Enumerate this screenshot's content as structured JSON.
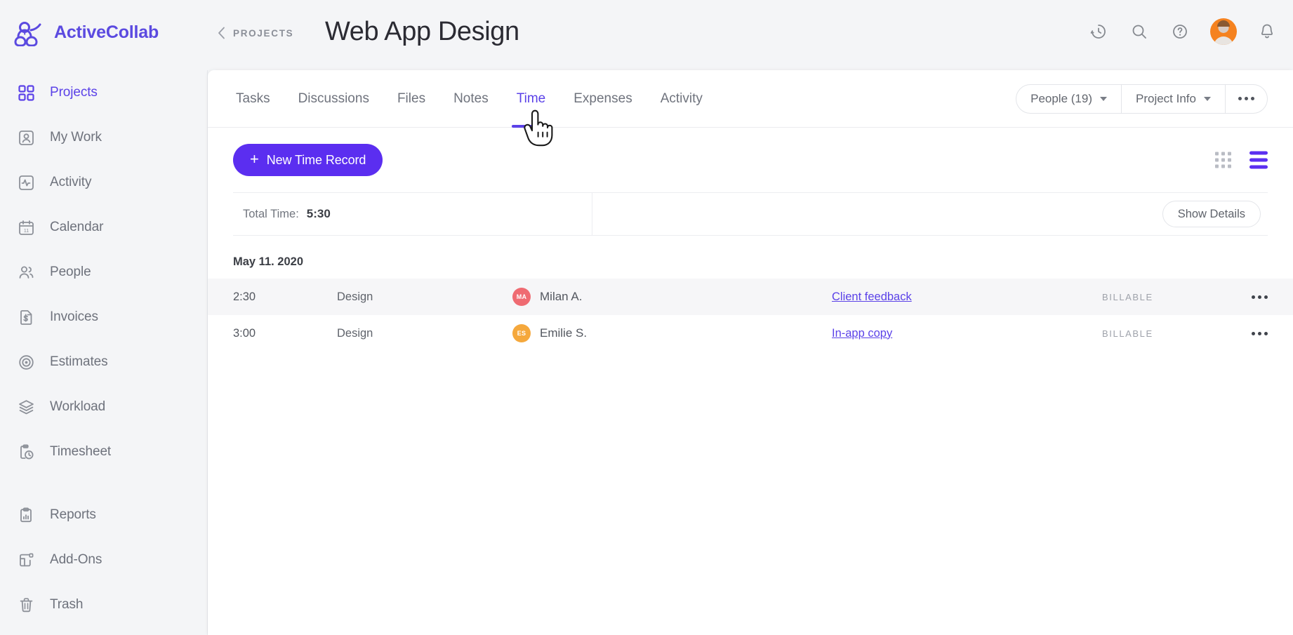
{
  "brand": {
    "name": "ActiveCollab",
    "logo_icon": "activecollab-logo-icon"
  },
  "header": {
    "breadcrumb_label": "PROJECTS",
    "breadcrumb_icon": "chevron-left-icon",
    "title": "Web App Design",
    "actions": [
      {
        "icon": "timer-clock-icon",
        "name": "timer-button"
      },
      {
        "icon": "search-icon",
        "name": "search-button"
      },
      {
        "icon": "help-question-icon",
        "name": "help-button"
      },
      {
        "icon": "avatar-icon",
        "name": "user-avatar"
      },
      {
        "icon": "bell-notification-icon",
        "name": "notifications-button"
      }
    ],
    "accent_color": "#5b42e8",
    "avatar_color": "#f5821f"
  },
  "sidebar": {
    "items": [
      {
        "label": "Projects",
        "icon": "grid-squares-icon",
        "active": true
      },
      {
        "label": "My Work",
        "icon": "person-card-icon",
        "active": false
      },
      {
        "label": "Activity",
        "icon": "pulse-chart-icon",
        "active": false
      },
      {
        "label": "Calendar",
        "icon": "calendar-icon",
        "active": false
      },
      {
        "label": "People",
        "icon": "people-icon",
        "active": false
      },
      {
        "label": "Invoices",
        "icon": "invoice-dollar-icon",
        "active": false
      },
      {
        "label": "Estimates",
        "icon": "target-icon",
        "active": false
      },
      {
        "label": "Workload",
        "icon": "layers-icon",
        "active": false
      },
      {
        "label": "Timesheet",
        "icon": "clipboard-clock-icon",
        "active": false
      }
    ],
    "items_bottom": [
      {
        "label": "Reports",
        "icon": "clipboard-chart-icon",
        "active": false
      },
      {
        "label": "Add-Ons",
        "icon": "addons-icon",
        "active": false
      },
      {
        "label": "Trash",
        "icon": "trash-icon",
        "active": false
      }
    ]
  },
  "main": {
    "tabs": [
      {
        "label": "Tasks",
        "active": false
      },
      {
        "label": "Discussions",
        "active": false
      },
      {
        "label": "Files",
        "active": false
      },
      {
        "label": "Notes",
        "active": false
      },
      {
        "label": "Time",
        "active": true
      },
      {
        "label": "Expenses",
        "active": false
      },
      {
        "label": "Activity",
        "active": false
      }
    ],
    "segmented": {
      "people_label": "People (19)",
      "project_info_label": "Project Info",
      "more_icon": "ellipsis-horizontal-icon"
    },
    "new_record_button": {
      "label": "New Time Record",
      "plus": "+"
    },
    "view_toggles": {
      "grid_icon": "grid-view-icon",
      "list_icon": "list-view-icon",
      "active": "list"
    },
    "total_bar": {
      "label": "Total Time:",
      "value": "5:30",
      "show_details_label": "Show Details"
    },
    "groups": [
      {
        "date": "May 11. 2020",
        "rows": [
          {
            "time": "2:30",
            "type": "Design",
            "user": "Milan A.",
            "initials": "MA",
            "avatar_color": "#ef6b72",
            "link": "Client feedback",
            "billable": "BILLABLE",
            "more_icon": "ellipsis-horizontal-icon",
            "highlighted": true
          },
          {
            "time": "3:00",
            "type": "Design",
            "user": "Emilie S.",
            "initials": "ES",
            "avatar_color": "#f5a83c",
            "link": "In-app copy",
            "billable": "BILLABLE",
            "more_icon": "ellipsis-horizontal-icon",
            "highlighted": false
          }
        ]
      }
    ]
  },
  "cursor": {
    "icon": "pointing-hand-cursor"
  }
}
